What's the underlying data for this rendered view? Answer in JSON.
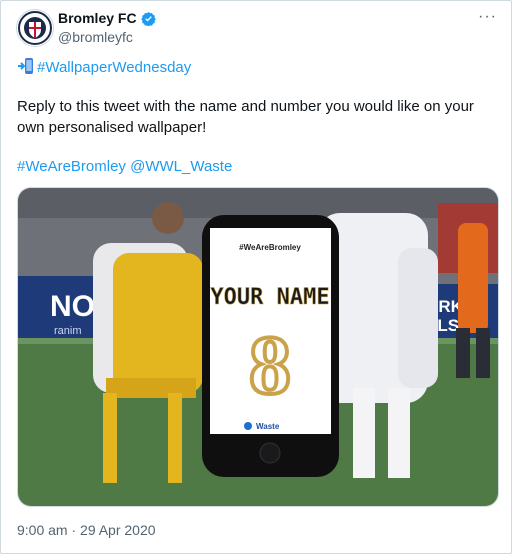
{
  "author": {
    "display_name": "Bromley FC",
    "handle": "@bromleyfc",
    "verified_icon": "verified-badge-icon",
    "avatar_icon": "club-crest-icon"
  },
  "menu": {
    "more_label": "···"
  },
  "tweet": {
    "line1_emoji": "mobile-phone-arrow-icon",
    "line1_tag": "#WallpaperWednesday",
    "line2": "Reply to this tweet with the name and number you would like on your",
    "line3": "own personalised wallpaper!",
    "line4_tag1": "#WeAreBromley",
    "line4_sep": " ",
    "line4_tag2": "@WWL_Waste"
  },
  "media": {
    "phone_header": "#WeAreBromley",
    "shirt_name": "YOUR NAME",
    "shirt_number": "8",
    "sponsor": "Waste",
    "banner_left": "NO",
    "banner_left2": "ranim",
    "banner_right": "VARK",
    "banner_right2": "TALS"
  },
  "timestamp": "9:00 am · 29 Apr 2020",
  "colors": {
    "link": "#1d9bf0",
    "secondary": "#536471",
    "pitch": "#4f7a45",
    "gold": "#c9a24a"
  }
}
